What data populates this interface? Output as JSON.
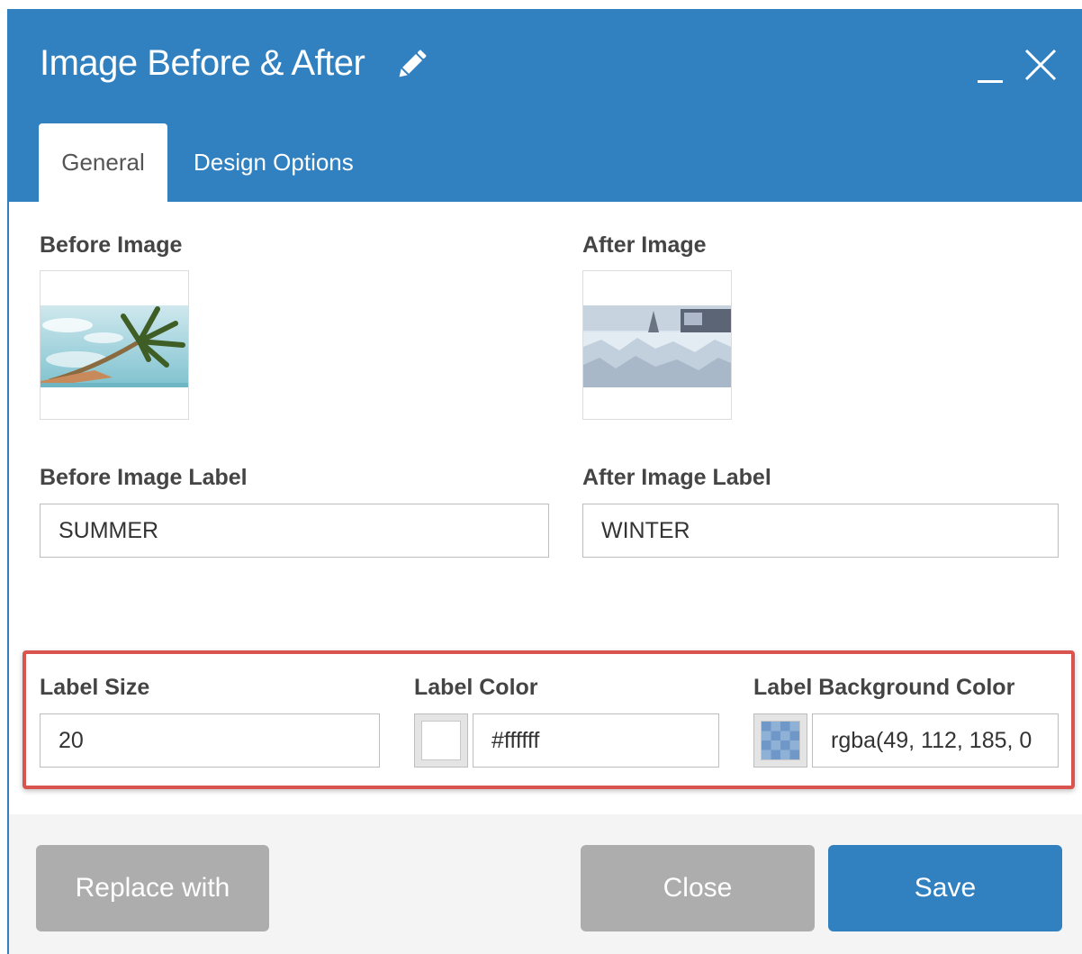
{
  "header": {
    "title": "Image Before & After",
    "title_icon": "pencil-icon",
    "controls": [
      "minimize-icon",
      "close-icon"
    ]
  },
  "tabs": [
    {
      "label": "General",
      "active": true
    },
    {
      "label": "Design Options",
      "active": false
    }
  ],
  "fields": {
    "before_image": {
      "label": "Before Image"
    },
    "after_image": {
      "label": "After Image"
    },
    "before_label": {
      "label": "Before Image Label",
      "value": "SUMMER"
    },
    "after_label": {
      "label": "After Image Label",
      "value": "WINTER"
    },
    "label_size": {
      "label": "Label Size",
      "value": "20"
    },
    "label_color": {
      "label": "Label Color",
      "value": "#ffffff"
    },
    "label_bg_color": {
      "label": "Label Background Color",
      "value": "rgba(49, 112, 185, 0"
    }
  },
  "buttons": {
    "replace": "Replace with",
    "close": "Close",
    "save": "Save"
  },
  "colors": {
    "header": "#3180c0",
    "save_button": "#3180c0",
    "disabled_button": "#adadad",
    "highlight_border": "#d9534f"
  }
}
